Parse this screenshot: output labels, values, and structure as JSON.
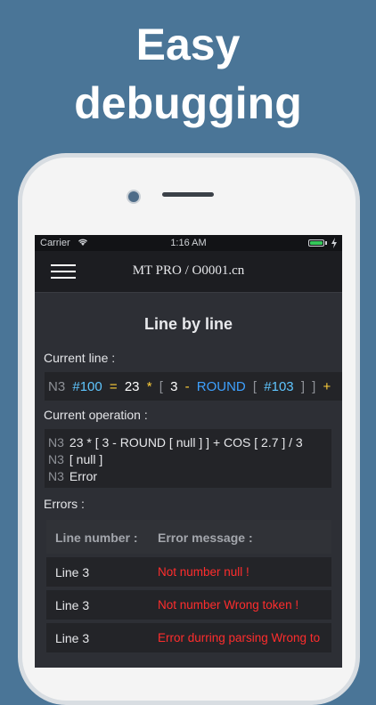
{
  "headline": {
    "line1": "Easy",
    "line2": "debugging"
  },
  "status_bar": {
    "carrier": "Carrier",
    "time": "1:16 AM"
  },
  "nav": {
    "title": "MT PRO / O0001.cn"
  },
  "main": {
    "section_title": "Line by line",
    "current_line_label": "Current line :",
    "current_line_tokens": [
      "N3",
      "#100",
      "=",
      "23",
      "*",
      "[",
      "3",
      "-",
      "ROUND",
      "[",
      "#103",
      "]",
      "]",
      "+"
    ],
    "current_operation_label": "Current operation :",
    "operation_lines": [
      {
        "n": "N3",
        "text": "23 * [ 3 - ROUND [ null ] ] + COS [ 2.7 ] / 3"
      },
      {
        "n": "N3",
        "text": "[ null ]"
      },
      {
        "n": "N3",
        "text": "Error"
      }
    ],
    "errors_label": "Errors :",
    "errors_table": {
      "headers": [
        "Line number :",
        "Error message :"
      ],
      "rows": [
        [
          "Line 3",
          "Not number null !"
        ],
        [
          "Line 3",
          "Not number Wrong token !"
        ],
        [
          "Line 3",
          "Error durring parsing Wrong to"
        ]
      ]
    }
  },
  "colors": {
    "background": "#4a7597",
    "error_text": "#ff2d2d",
    "variable": "#5fc6ff",
    "operator": "#ffcf3a",
    "function": "#3ea1ff"
  }
}
